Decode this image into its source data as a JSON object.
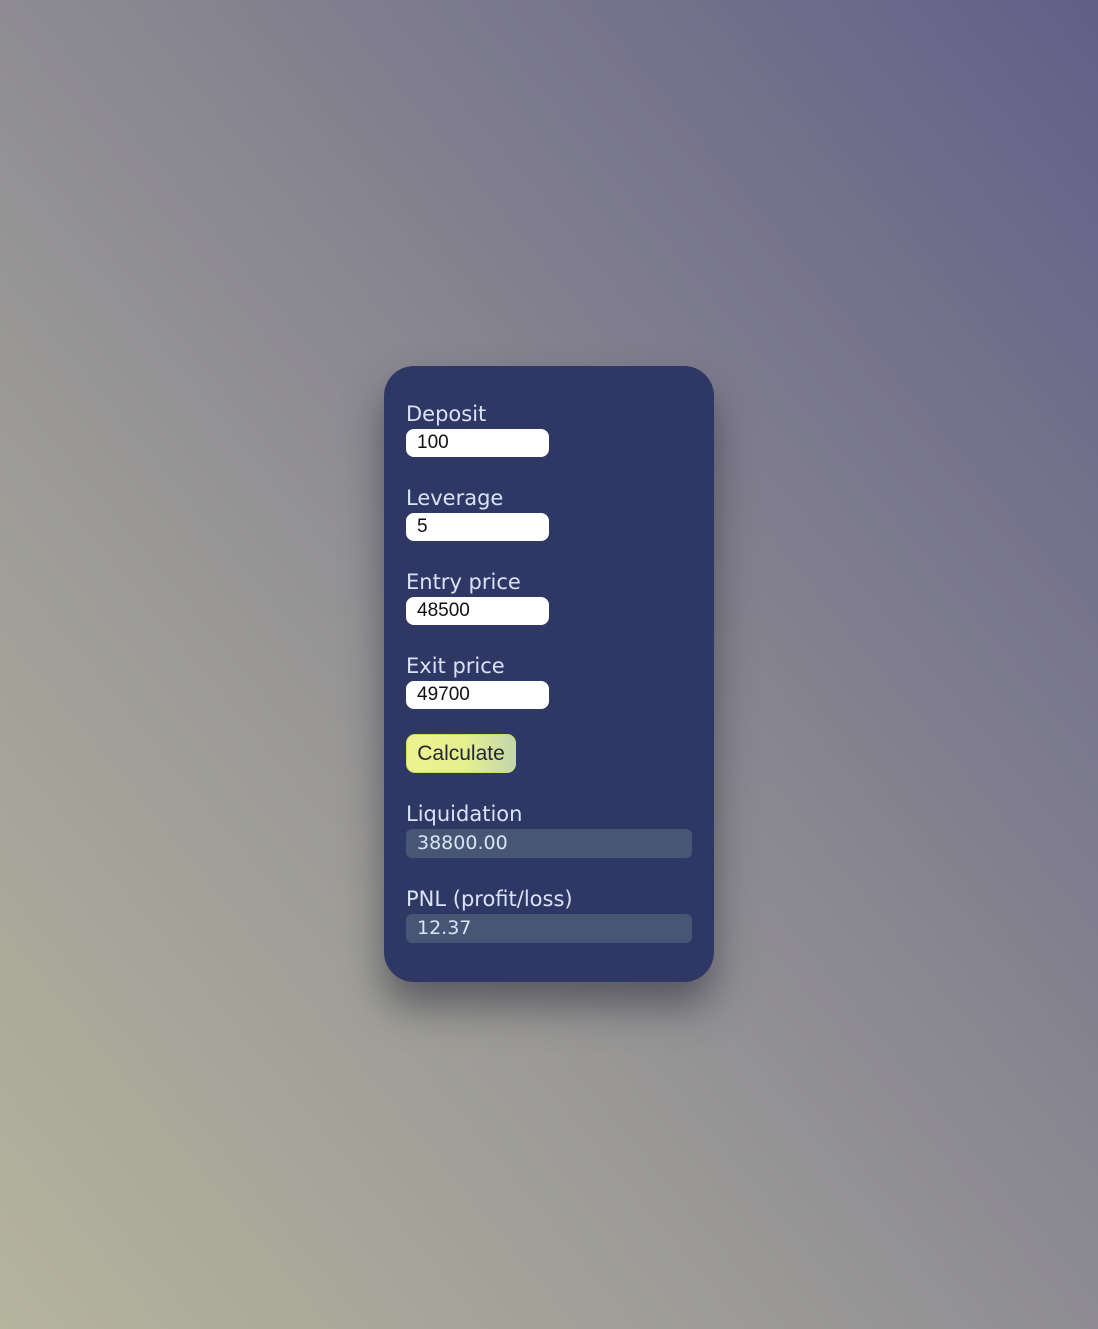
{
  "form": {
    "deposit": {
      "label": "Deposit",
      "value": "100"
    },
    "leverage": {
      "label": "Leverage",
      "value": "5"
    },
    "entry_price": {
      "label": "Entry price",
      "value": "48500"
    },
    "exit_price": {
      "label": "Exit price",
      "value": "49700"
    },
    "calculate_label": "Calculate"
  },
  "results": {
    "liquidation": {
      "label": "Liquidation",
      "value": "38800.00"
    },
    "pnl": {
      "label": "PNL (profit/loss)",
      "value": "12.37"
    }
  },
  "colors": {
    "card_bg": "#2f3865",
    "button_accent": "#e4ef8f",
    "output_bg": "#475675",
    "label_text": "#d9e3f7"
  }
}
